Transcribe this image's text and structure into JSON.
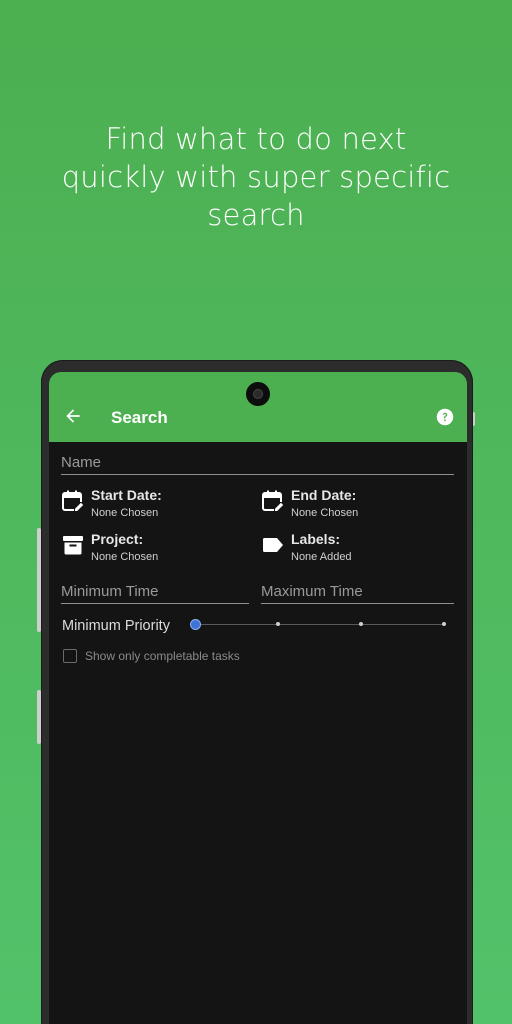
{
  "headline": {
    "line1": "Find what to do next",
    "line2": "quickly with super specific",
    "line3": "search"
  },
  "appbar": {
    "title": "Search",
    "back_icon": "arrow-left-icon",
    "help_icon": "help-circle-icon",
    "color": "#4caf50"
  },
  "form": {
    "name_placeholder": "Name",
    "start_date": {
      "label": "Start Date:",
      "value": "None Chosen",
      "icon": "calendar-edit-icon"
    },
    "end_date": {
      "label": "End Date:",
      "value": "None Chosen",
      "icon": "calendar-edit-icon"
    },
    "project": {
      "label": "Project:",
      "value": "None Chosen",
      "icon": "archive-box-icon"
    },
    "labels": {
      "label": "Labels:",
      "value": "None Added",
      "icon": "label-tag-icon"
    },
    "min_time_placeholder": "Minimum Time",
    "max_time_placeholder": "Maximum Time",
    "priority": {
      "label": "Minimum Priority",
      "steps": 4,
      "selected_index": 0
    },
    "completable": {
      "label": "Show only completable tasks",
      "checked": false
    }
  },
  "colors": {
    "background": "#4caf50",
    "screen": "#141414",
    "accent": "#3f73d8"
  }
}
